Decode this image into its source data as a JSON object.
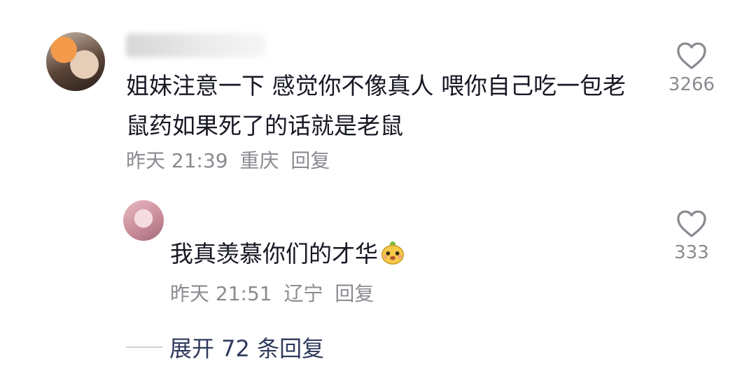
{
  "comments": [
    {
      "text": "姐妹注意一下 感觉你不像真人 喂你自己吃一包老鼠药如果死了的话就是老鼠",
      "time": "昨天 21:39",
      "location": "重庆",
      "reply_label": "回复",
      "likes": "3266",
      "like_icon": "heart-outline-icon"
    },
    {
      "text": "我真羡慕你们的才华",
      "emoji": "cute-face-emoji",
      "time": "昨天 21:51",
      "location": "辽宁",
      "reply_label": "回复",
      "likes": "333",
      "like_icon": "heart-outline-icon"
    }
  ],
  "expand_replies": "展开 72 条回复",
  "colors": {
    "text": "#161823",
    "meta": "#8a8b91",
    "link": "#2f3a5c"
  }
}
